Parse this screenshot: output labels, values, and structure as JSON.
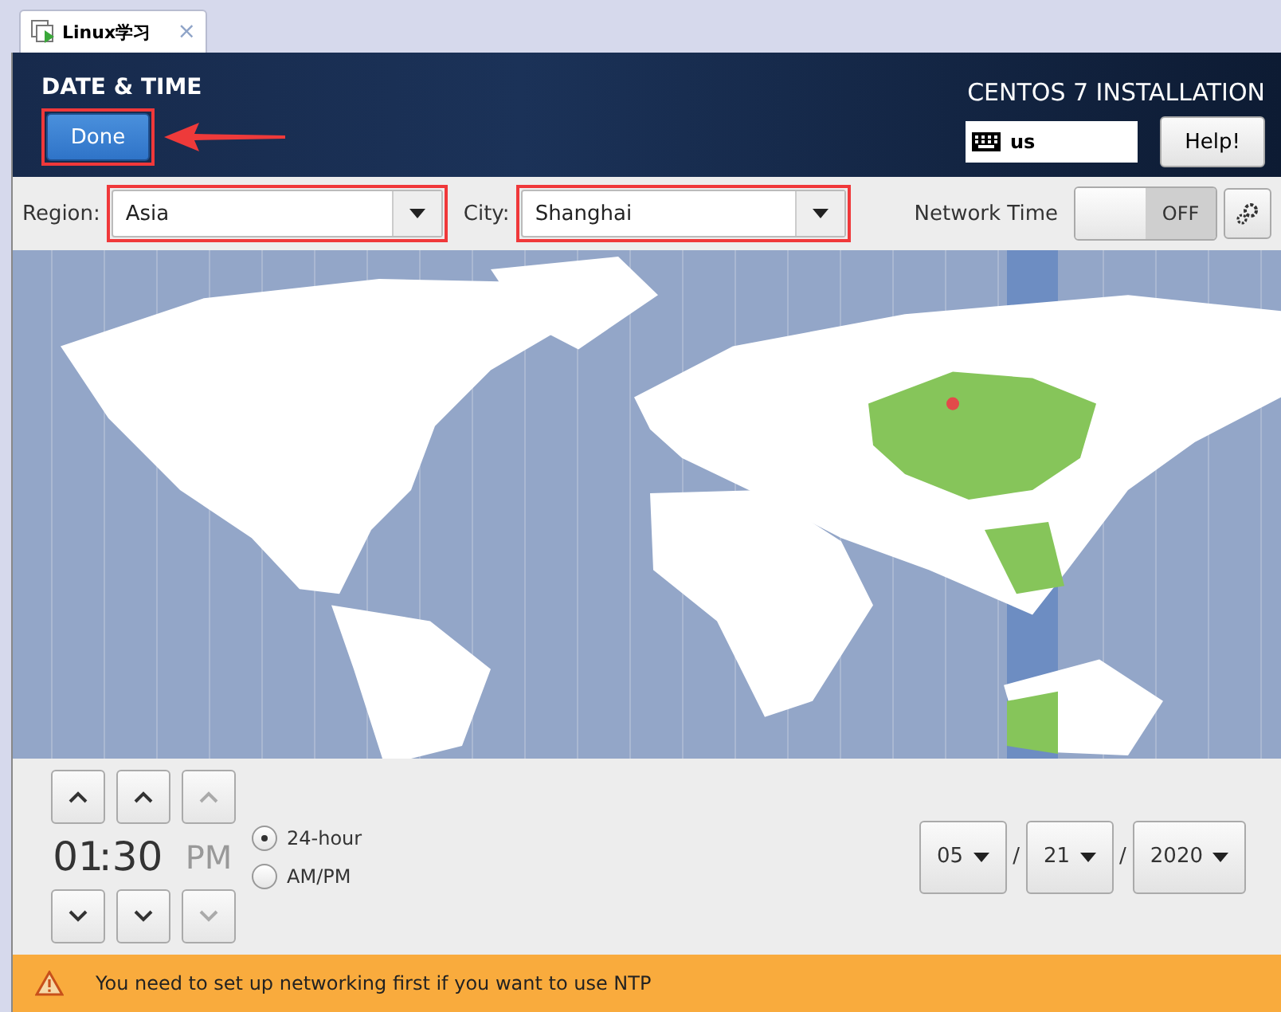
{
  "tab": {
    "label": "Linux学习",
    "close": "×"
  },
  "header": {
    "title": "DATE & TIME",
    "done": {
      "label": "Done",
      "highlighted": true
    },
    "product": "CENTOS 7 INSTALLATION",
    "keyboard": "us",
    "help": "Help!"
  },
  "toolbar": {
    "region": {
      "label": "Region:",
      "value": "Asia",
      "highlighted": true
    },
    "city": {
      "label": "City:",
      "value": "Shanghai",
      "highlighted": true
    },
    "network_time": {
      "label": "Network Time",
      "on": false,
      "state_text": "OFF"
    }
  },
  "time": {
    "hours": "01",
    "separator": ":",
    "minutes": "30",
    "period": "PM",
    "period_disabled": true,
    "formats": [
      {
        "label": "24-hour",
        "selected": true
      },
      {
        "label": "AM/PM",
        "selected": false
      }
    ]
  },
  "date": {
    "fields": [
      "05",
      "21",
      "2020"
    ],
    "separator": "/"
  },
  "warning": "You need to set up networking first if you want to use NTP"
}
